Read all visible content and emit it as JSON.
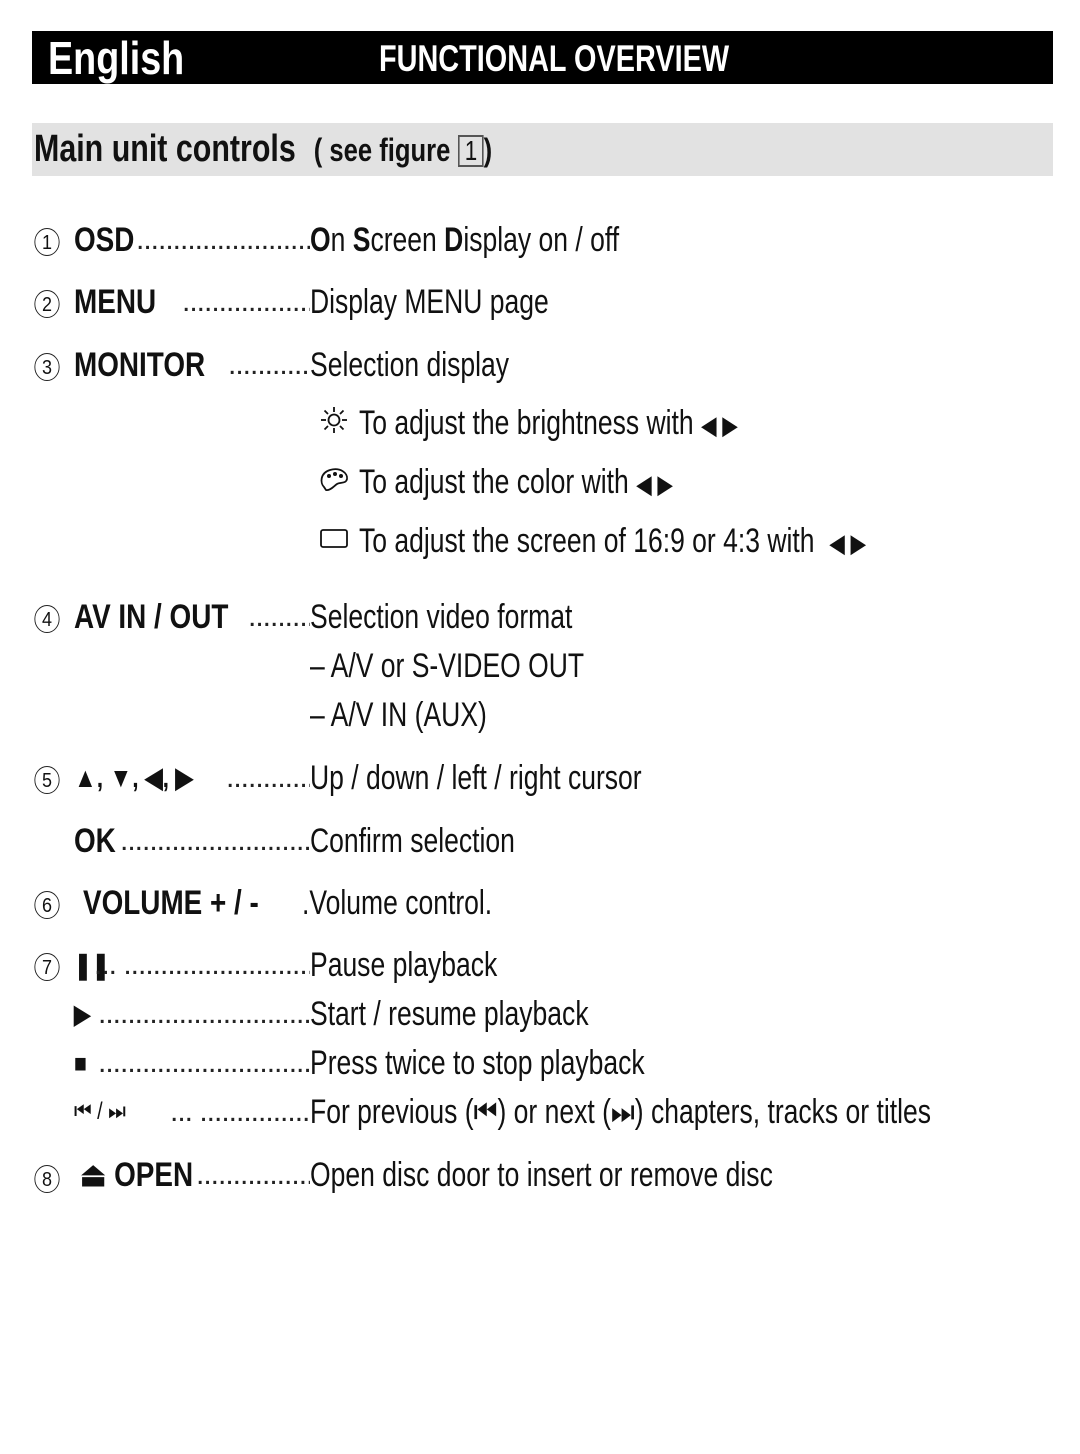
{
  "header": {
    "language": "English",
    "title": "FUNCTIONAL OVERVIEW"
  },
  "section": {
    "title": "Main unit controls",
    "see_prefix": "( see figure",
    "figure_number": "1",
    "see_suffix": ")"
  },
  "controls": [
    {
      "number": "1",
      "key": "OSD",
      "desc_parts": [
        "O",
        "n ",
        "S",
        "creen ",
        "D",
        "isplay on / off"
      ]
    },
    {
      "number": "2",
      "key": "MENU",
      "desc": "Display MENU page"
    },
    {
      "number": "3",
      "key": "MONITOR",
      "desc": "Selection display",
      "sub_items": [
        {
          "icon": "brightness-icon",
          "glyph": "☼",
          "text": "To adjust the brightness with",
          "arrows": "◀ ▶"
        },
        {
          "icon": "color-palette-icon",
          "glyph": "🎨",
          "text": "To adjust the color with",
          "arrows": "◀ ▶"
        },
        {
          "icon": "screen-ratio-icon",
          "glyph": "▭",
          "text": "To adjust the screen of 16:9 or 4:3 with",
          "arrows": "◀ ▶"
        }
      ]
    },
    {
      "number": "4",
      "key": "AV IN / OUT",
      "desc": "Selection video format",
      "options": [
        "–  A/V or S-VIDEO OUT",
        "–  A/V IN (AUX)"
      ]
    },
    {
      "number": "5",
      "key": "▲, ▼, ◀, ▶",
      "desc": "Up / down / left / right cursor"
    },
    {
      "number": "",
      "key": "OK",
      "desc": "Confirm selection"
    },
    {
      "number": "6",
      "key": "VOLUME + / -",
      "desc": ".Volume control."
    },
    {
      "number": "7",
      "key": "❚❚",
      "desc": "Pause playback"
    },
    {
      "number": "",
      "key": "▶",
      "desc": "Start / resume playback"
    },
    {
      "number": "",
      "key": "■",
      "desc": "Press twice to stop playback"
    },
    {
      "number": "",
      "key": "⏮ / ⏭",
      "desc": "For previous (⏮) or next (⏭) chapters, tracks or titles"
    },
    {
      "number": "8",
      "key": "⏏ OPEN",
      "desc": "Open disc door to insert or remove disc"
    }
  ]
}
